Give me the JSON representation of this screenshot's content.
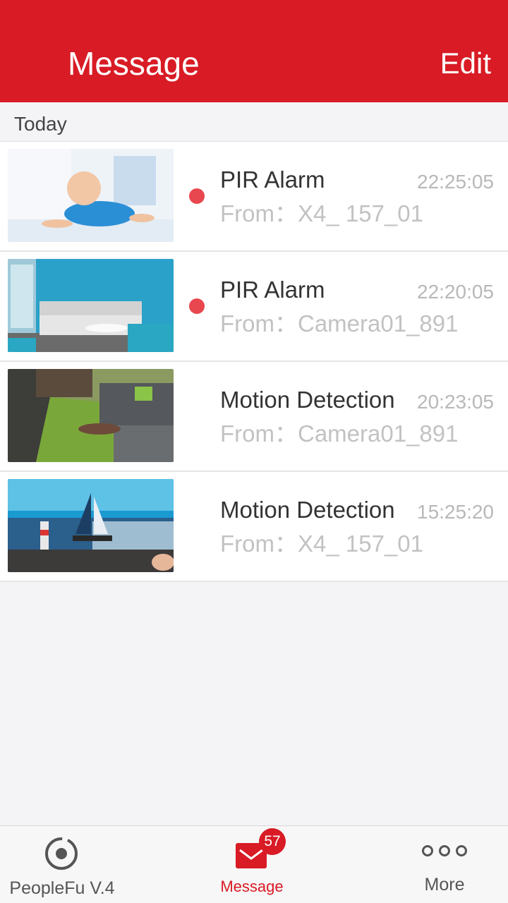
{
  "header": {
    "title": "Message",
    "edit_label": "Edit",
    "color": "#d81b25"
  },
  "section": {
    "label": "Today"
  },
  "messages": [
    {
      "title": "PIR Alarm",
      "time": "22:25:05",
      "from": "From：X4_ 157_01",
      "unread": true,
      "thumbnail": "baby-crawling"
    },
    {
      "title": "PIR Alarm",
      "time": "22:20:05",
      "from": "From：Camera01_891",
      "unread": true,
      "thumbnail": "living-room-sofa"
    },
    {
      "title": "Motion Detection",
      "time": "20:23:05",
      "from": "From：Camera01_891",
      "unread": false,
      "thumbnail": "living-room-rug"
    },
    {
      "title": "Motion Detection",
      "time": "15:25:20",
      "from": "From：X4_ 157_01",
      "unread": false,
      "thumbnail": "sailboat-lighthouse"
    }
  ],
  "tabbar": {
    "tabs": [
      {
        "label": "PeopleFu V.4",
        "icon": "camera-lens-icon",
        "active": false
      },
      {
        "label": "Message",
        "icon": "envelope-icon",
        "active": true
      },
      {
        "label": "More",
        "icon": "more-dots-icon",
        "active": false
      }
    ],
    "badge": "57"
  }
}
